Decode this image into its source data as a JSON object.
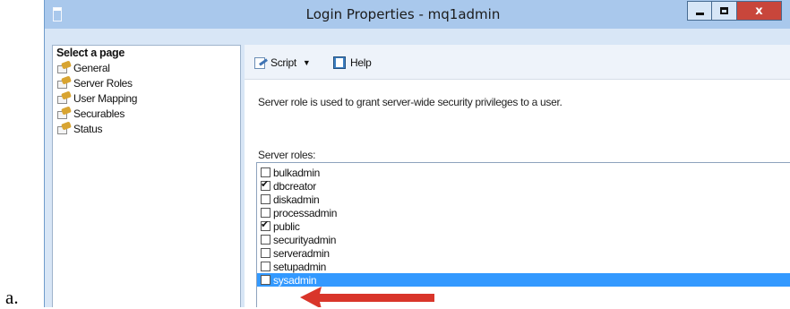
{
  "outer_label": "a.",
  "window": {
    "title": "Login Properties - mq1admin"
  },
  "titlebar_buttons": {
    "close_glyph": "x"
  },
  "left_pane": {
    "header": "Select a page",
    "pages": [
      {
        "label": "General",
        "icon": "wrench-page-icon"
      },
      {
        "label": "Server Roles",
        "icon": "wrench-page-icon"
      },
      {
        "label": "User Mapping",
        "icon": "wrench-page-icon"
      },
      {
        "label": "Securables",
        "icon": "wrench-page-icon"
      },
      {
        "label": "Status",
        "icon": "wrench-page-icon"
      }
    ]
  },
  "toolbar": {
    "script_label": "Script",
    "help_label": "Help"
  },
  "description": "Server role is used to grant server-wide security privileges to a user.",
  "roles_label": "Server roles:",
  "roles": [
    {
      "label": "bulkadmin",
      "checked": false,
      "selected": false
    },
    {
      "label": "dbcreator",
      "checked": true,
      "selected": false
    },
    {
      "label": "diskadmin",
      "checked": false,
      "selected": false
    },
    {
      "label": "processadmin",
      "checked": false,
      "selected": false
    },
    {
      "label": "public",
      "checked": true,
      "selected": false
    },
    {
      "label": "securityadmin",
      "checked": false,
      "selected": false
    },
    {
      "label": "serveradmin",
      "checked": false,
      "selected": false
    },
    {
      "label": "setupadmin",
      "checked": false,
      "selected": false
    },
    {
      "label": "sysadmin",
      "checked": false,
      "selected": true
    }
  ],
  "colors": {
    "titlebar": "#a9c8ec",
    "close_button": "#c8463b",
    "selection": "#3399ff",
    "annotation_arrow": "#d9352a"
  }
}
